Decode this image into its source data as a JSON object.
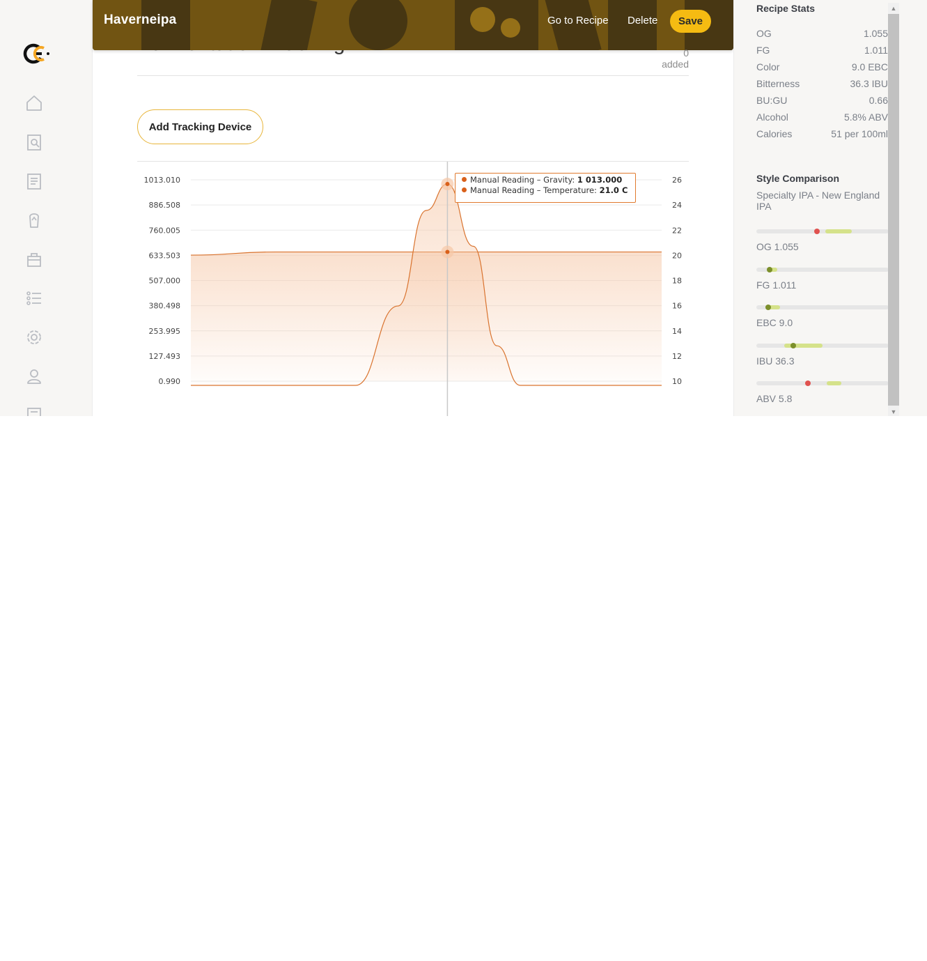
{
  "header": {
    "title": "Haverneipa",
    "go_to_recipe": "Go to Recipe",
    "delete": "Delete",
    "save": "Save"
  },
  "section": {
    "title": "Fermentation Tracking",
    "meta": "0 added",
    "add_device": "Add Tracking Device"
  },
  "nav": {
    "items": [
      "home-icon",
      "recipe-search-icon",
      "recipes-list-icon",
      "ingredients-icon",
      "equipment-icon",
      "lists-icon",
      "settings-icon",
      "profile-icon",
      "document-icon"
    ]
  },
  "chart_data": {
    "type": "area",
    "left_axis_ticks": [
      "1013.010",
      "886.508",
      "760.005",
      "633.503",
      "507.000",
      "380.498",
      "253.995",
      "127.493",
      "0.990"
    ],
    "right_axis_ticks": [
      "26",
      "24",
      "22",
      "20",
      "18",
      "16",
      "14",
      "12",
      "10"
    ],
    "left_axis_range": [
      0.99,
      1013.01
    ],
    "right_axis_range": [
      10,
      26
    ],
    "grid": true,
    "series": [
      {
        "name": "Manual Reading – Gravity",
        "axis": "left",
        "x": [
          0,
          0.35,
          0.44,
          0.5,
          0.545,
          0.6,
          0.65,
          0.7,
          1.0
        ],
        "values": [
          0.99,
          0.99,
          400,
          880,
          1013.0,
          700,
          200,
          0.99,
          0.99
        ]
      },
      {
        "name": "Manual Reading – Temperature",
        "axis": "left",
        "x": [
          0,
          0.18,
          0.3,
          0.545,
          1.0
        ],
        "values": [
          20.35,
          20.6,
          20.6,
          20.6,
          20.6
        ]
      }
    ],
    "tooltip": {
      "rows": [
        {
          "label": "Manual Reading – Gravity:",
          "value": "1 013.000"
        },
        {
          "label": "Manual Reading – Temperature:",
          "value": "21.0 C"
        }
      ]
    },
    "colors": {
      "line": "#d9732e",
      "fill": "#f6c7a6",
      "marker": "#d9601a"
    }
  },
  "sidebar": {
    "stats_title": "Recipe Stats",
    "stats": [
      {
        "label": "OG",
        "value": "1.055"
      },
      {
        "label": "FG",
        "value": "1.011"
      },
      {
        "label": "Color",
        "value": "9.0 EBC"
      },
      {
        "label": "Bitterness",
        "value": "36.3 IBU"
      },
      {
        "label": "BU:GU",
        "value": "0.66"
      },
      {
        "label": "Alcohol",
        "value": "5.8% ABV"
      },
      {
        "label": "Calories",
        "value": "51 per 100ml"
      }
    ],
    "style_title": "Style Comparison",
    "style_name": "Specialty IPA - New England IPA",
    "style_bars": [
      {
        "label": "OG 1.055",
        "range_start": 0.52,
        "range_end": 0.72,
        "value": 0.46,
        "in_range": false
      },
      {
        "label": "FG 1.011",
        "range_start": 0.09,
        "range_end": 0.16,
        "value": 0.1,
        "in_range": true
      },
      {
        "label": "EBC 9.0",
        "range_start": 0.07,
        "range_end": 0.18,
        "value": 0.09,
        "in_range": true
      },
      {
        "label": "IBU 36.3",
        "range_start": 0.21,
        "range_end": 0.5,
        "value": 0.28,
        "in_range": true
      },
      {
        "label": "ABV 5.8",
        "range_start": 0.53,
        "range_end": 0.64,
        "value": 0.39,
        "in_range": false
      }
    ],
    "colors": {
      "in_range": "#7c8f2b",
      "out_of_range": "#e0524f",
      "range": "#d5e28a"
    }
  }
}
